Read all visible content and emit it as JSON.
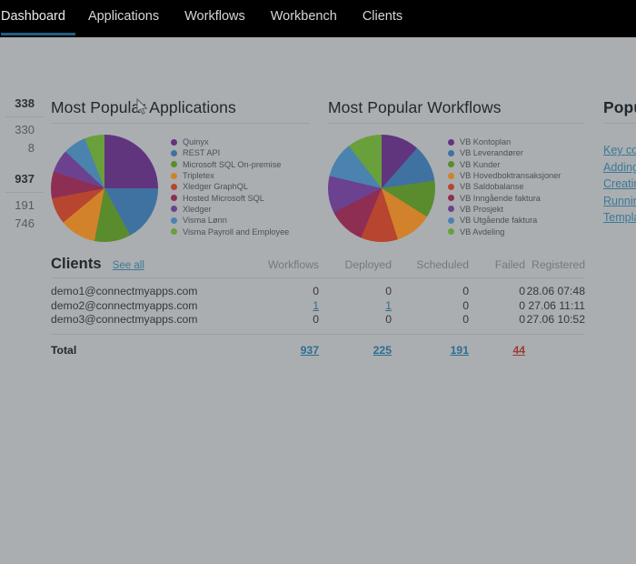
{
  "topnav": {
    "items": [
      {
        "label": "Dashboard",
        "active": true
      },
      {
        "label": "Applications",
        "active": false
      },
      {
        "label": "Workflows",
        "active": false
      },
      {
        "label": "Workbench",
        "active": false
      },
      {
        "label": "Clients",
        "active": false
      }
    ],
    "active_underline_color": "#1f5f84",
    "background_color": "#000000"
  },
  "left_column": {
    "rows": [
      {
        "value": "338",
        "bold": true
      },
      {
        "divider": true
      },
      {
        "value": "330",
        "bold": false
      },
      {
        "value": "8",
        "bold": false
      },
      {
        "value": "937",
        "bold": true
      },
      {
        "divider": true
      },
      {
        "value": "191",
        "bold": false
      },
      {
        "value": "746",
        "bold": false
      }
    ]
  },
  "apps_panel": {
    "title": "Most Popular Applications"
  },
  "wf_panel": {
    "title": "Most Popular Workflows"
  },
  "popular_panel": {
    "title": "Popu",
    "links": [
      "Key con",
      "Adding",
      "Creatin",
      "Runnin",
      "Templa"
    ]
  },
  "clients": {
    "title": "Clients",
    "see_all_label": "See all",
    "columns": [
      "",
      "Workflows",
      "Deployed",
      "Scheduled",
      "Failed",
      "Registered"
    ],
    "rows": [
      {
        "email": "demo1@connectmyapps.com",
        "workflows": "0",
        "workflows_link": false,
        "deployed": "0",
        "deployed_link": false,
        "scheduled": "0",
        "failed": "0",
        "registered": "28.06 07:48"
      },
      {
        "email": "demo2@connectmyapps.com",
        "workflows": "1",
        "workflows_link": true,
        "deployed": "1",
        "deployed_link": true,
        "scheduled": "0",
        "failed": "0",
        "registered": "27.06 11:11"
      },
      {
        "email": "demo3@connectmyapps.com",
        "workflows": "0",
        "workflows_link": false,
        "deployed": "0",
        "deployed_link": false,
        "scheduled": "0",
        "failed": "0",
        "registered": "27.06 10:52"
      }
    ],
    "total": {
      "label": "Total",
      "workflows": "937",
      "deployed": "225",
      "scheduled": "191",
      "failed": "44",
      "registered": ""
    }
  },
  "chart_data": [
    {
      "type": "pie",
      "title": "Most Popular Applications",
      "legend_position": "right",
      "categories": [
        "Quinyx",
        "REST API",
        "Microsoft SQL On-premise",
        "Tripletex",
        "Xledger GraphQL",
        "Hosted Microsoft SQL",
        "Xledger",
        "Visma Lønn",
        "Visma Payroll and Employee"
      ],
      "values": [
        25,
        17,
        11,
        11,
        8,
        8,
        7,
        7,
        6
      ],
      "colors": [
        "#61347e",
        "#3f72a0",
        "#5a8c2e",
        "#d1822a",
        "#b8452f",
        "#8e2e52",
        "#6b4190",
        "#4a83ad",
        "#6aa03b"
      ]
    },
    {
      "type": "pie",
      "title": "Most Popular Workflows",
      "legend_position": "right",
      "categories": [
        "VB Kontoplan",
        "VB Leverandører",
        "VB Kunder",
        "VB Hovedboktransaksjoner",
        "VB Saldobalanse",
        "VB Inngående faktura",
        "VB Prosjekt",
        "VB Utgående faktura",
        "VB Avdeling"
      ],
      "values": [
        11.5,
        11.2,
        11.2,
        11.2,
        11.2,
        11.2,
        11.2,
        10.8,
        10.5
      ],
      "colors": [
        "#61347e",
        "#3f72a0",
        "#5a8c2e",
        "#d1822a",
        "#b8452f",
        "#8e2e52",
        "#6b4190",
        "#4a83ad",
        "#6aa03b"
      ]
    }
  ]
}
